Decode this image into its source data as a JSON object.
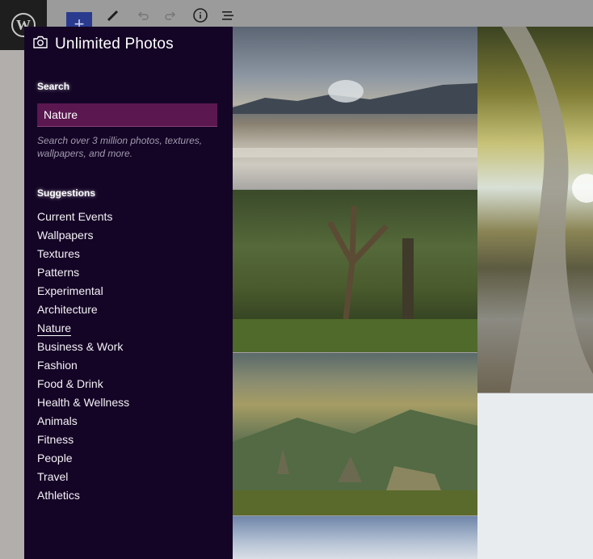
{
  "app": {
    "title": "Unlimited Photos"
  },
  "search": {
    "label": "Search",
    "value": "Nature",
    "help": "Search over 3 million photos, textures, wallpapers, and more."
  },
  "suggestions": {
    "label": "Suggestions",
    "active": "Nature",
    "items": [
      "Current Events",
      "Wallpapers",
      "Textures",
      "Patterns",
      "Experimental",
      "Architecture",
      "Nature",
      "Business & Work",
      "Fashion",
      "Food & Drink",
      "Health & Wellness",
      "Animals",
      "Fitness",
      "People",
      "Travel",
      "Athletics"
    ]
  },
  "toolbar": {
    "add_label": "+"
  },
  "icons": {
    "logo": "wordpress-logo-icon",
    "camera": "camera-icon",
    "pen": "pen-icon",
    "undo": "undo-icon",
    "redo": "redo-icon",
    "info": "info-icon",
    "list": "list-view-icon"
  },
  "colors": {
    "sidebar_bg": "#140526",
    "input_bg": "#5a1750",
    "add_button": "#2a3b8f"
  },
  "photos": [
    {
      "subject": "geothermal-landscape-photo"
    },
    {
      "subject": "giant-tree-roots-photo"
    },
    {
      "subject": "forest-tree-photo"
    },
    {
      "subject": "mountain-valley-photo"
    },
    {
      "subject": "white-photo"
    },
    {
      "subject": "sky-clouds-photo"
    }
  ]
}
